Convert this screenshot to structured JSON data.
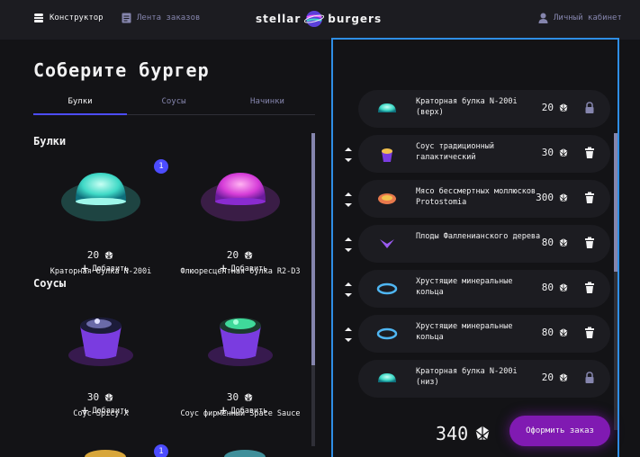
{
  "header": {
    "constructor_label": "Конструктор",
    "feed_label": "Лента заказов",
    "logo_left": "stellar",
    "logo_right": "burgers",
    "account_label": "Личный кабинет"
  },
  "colors": {
    "accent": "#4c4cff",
    "order_button": "#801ab2",
    "selection_border": "#2f8ee5",
    "inactive_text": "#8585ad"
  },
  "title": "Соберите бургер",
  "tabs": [
    {
      "label": "Булки",
      "active": true
    },
    {
      "label": "Соусы",
      "active": false
    },
    {
      "label": "Начинки",
      "active": false
    }
  ],
  "sections": {
    "buns": {
      "title": "Булки",
      "items": [
        {
          "price": "20",
          "name": "Краторная булка N-200i",
          "count": "1",
          "add_label": "Добавить",
          "icon": "crater-bun"
        },
        {
          "price": "20",
          "name": "Флюоресцентная булка R2-D3",
          "count": "",
          "add_label": "Добавить",
          "icon": "fluorescent-bun"
        }
      ]
    },
    "sauces": {
      "title": "Соусы",
      "items": [
        {
          "price": "30",
          "name": "Соус Spicy-X",
          "count": "",
          "add_label": "Добавить",
          "icon": "sauce-bowl"
        },
        {
          "price": "30",
          "name": "Соус фирменный Space Sauce",
          "count": "",
          "add_label": "Добавить",
          "icon": "sauce-bowl"
        }
      ]
    },
    "next_counter": "1"
  },
  "constructor": {
    "items": [
      {
        "name": "Краторная булка N-200i (верх)",
        "price": "20",
        "locked": true,
        "icon": "crater-bun"
      },
      {
        "name": "Соус традиционный галактический",
        "price": "30",
        "locked": false,
        "icon": "sauce"
      },
      {
        "name": "Мясо бессмертных моллюсков Protostomia",
        "price": "300",
        "locked": false,
        "icon": "meat"
      },
      {
        "name": "Плоды Фалленианского дерева",
        "price": "80",
        "locked": false,
        "icon": "fruit"
      },
      {
        "name": "Хрустящие минеральные кольца",
        "price": "80",
        "locked": false,
        "icon": "rings"
      },
      {
        "name": "Хрустящие минеральные кольца",
        "price": "80",
        "locked": false,
        "icon": "rings"
      },
      {
        "name": "Краторная булка N-200i (низ)",
        "price": "20",
        "locked": true,
        "icon": "crater-bun"
      }
    ],
    "total": "340",
    "order_button": "Оформить заказ"
  }
}
